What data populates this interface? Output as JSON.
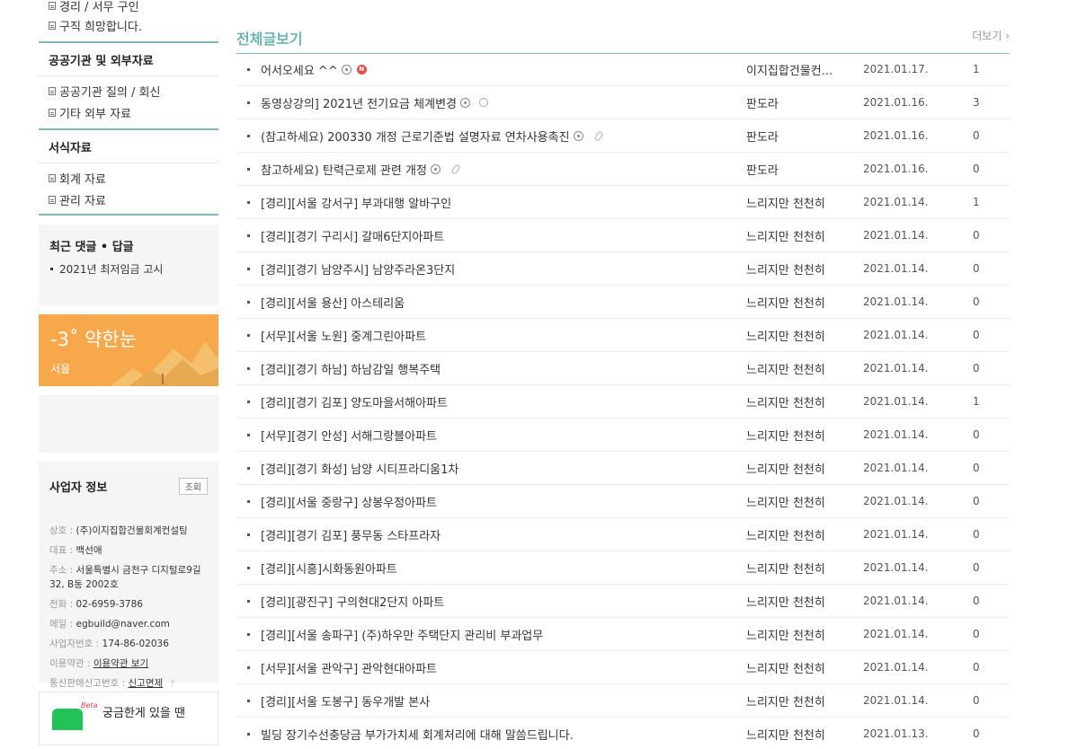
{
  "sidebar": {
    "group1": {
      "items": [
        {
          "label": "경리 / 서무 구인"
        },
        {
          "label": "구직 희망합니다."
        }
      ]
    },
    "group2": {
      "title": "공공기관 및 외부자료",
      "items": [
        {
          "label": "공공기관 질의 / 회신"
        },
        {
          "label": "기타 외부 자료"
        }
      ]
    },
    "group3": {
      "title": "서식자료",
      "items": [
        {
          "label": "회계 자료"
        },
        {
          "label": "관리 자료"
        }
      ]
    },
    "recent": {
      "title": "최근 댓글 • 답글",
      "items": [
        {
          "label": "2021년 최저임금 고시"
        }
      ]
    },
    "weather": {
      "temp": "-3˚ 약한눈",
      "city": "서울"
    },
    "business": {
      "title": "사업자 정보",
      "button": "조회",
      "lines": [
        {
          "key": "상호 : ",
          "value": "(주)이지집합건물회계컨설팅"
        },
        {
          "key": "대표 : ",
          "value": "백선애"
        },
        {
          "key": "주소 : ",
          "value": "서울특별시 금천구 디지털로9길 32, B동 2002호"
        },
        {
          "key": "전화 : ",
          "value": "02-6959-3786"
        },
        {
          "key": "메일 : ",
          "value": "egbuild@naver.com"
        },
        {
          "key": "사업자번호 : ",
          "value": "174-86-02036"
        },
        {
          "key": "이용약관 : ",
          "value": "이용약관 보기"
        },
        {
          "key": "통신판매신고번호 : ",
          "value": "신고면제"
        }
      ],
      "help_mark": "?"
    },
    "help": {
      "beta": "Beta",
      "text": "궁금한게 있을 땐"
    }
  },
  "main": {
    "section_title": "전체글보기",
    "more_label": "더보기 ›",
    "rows": [
      {
        "title": "어서오세요 ^^",
        "author": "이지집합건물컨...",
        "date": "2021.01.17.",
        "count": "1"
      },
      {
        "title": "동영상강의] 2021년 전기요금 체계변경",
        "author": "판도라",
        "date": "2021.01.16.",
        "count": "3"
      },
      {
        "title": "(참고하세요) 200330 개정 근로기준법 설명자료 연차사용촉진",
        "author": "판도라",
        "date": "2021.01.16.",
        "count": "0"
      },
      {
        "title": "참고하세요) 탄력근로제 관련 개정",
        "author": "판도라",
        "date": "2021.01.16.",
        "count": "0"
      },
      {
        "title": "[경리][서울 강서구] 부과대행 알바구인",
        "author": "느리지만 천천히",
        "date": "2021.01.14.",
        "count": "1"
      },
      {
        "title": "[경리][경기 구리시] 갈매6단지아파트",
        "author": "느리지만 천천히",
        "date": "2021.01.14.",
        "count": "0"
      },
      {
        "title": "[경리][경기 남양주시] 남양주라온3단지",
        "author": "느리지만 천천히",
        "date": "2021.01.14.",
        "count": "0"
      },
      {
        "title": "[경리][서울 용산] 아스테리움",
        "author": "느리지만 천천히",
        "date": "2021.01.14.",
        "count": "0"
      },
      {
        "title": "[서무][서울 노원] 중계그린아파트",
        "author": "느리지만 천천히",
        "date": "2021.01.14.",
        "count": "0"
      },
      {
        "title": "[경리][경기 하남] 하남감일 행복주택",
        "author": "느리지만 천천히",
        "date": "2021.01.14.",
        "count": "0"
      },
      {
        "title": "[경리][경기 김포] 양도마을서해아파트",
        "author": "느리지만 천천히",
        "date": "2021.01.14.",
        "count": "1"
      },
      {
        "title": "[서무][경기 안성] 서해그랑블아파트",
        "author": "느리지만 천천히",
        "date": "2021.01.14.",
        "count": "0"
      },
      {
        "title": "[경리][경기 화성] 남양 시티프라디움1차",
        "author": "느리지만 천천히",
        "date": "2021.01.14.",
        "count": "0"
      },
      {
        "title": "[경리][서울 중랑구] 상봉우정아파트",
        "author": "느리지만 천천히",
        "date": "2021.01.14.",
        "count": "0"
      },
      {
        "title": "[경리][경기 김포] 풍무동 스타프라자",
        "author": "느리지만 천천히",
        "date": "2021.01.14.",
        "count": "0"
      },
      {
        "title": "[경리][시흥]시화동원아파트",
        "author": "느리지만 천천히",
        "date": "2021.01.14.",
        "count": "0"
      },
      {
        "title": "[경리][광진구] 구의현대2단지 아파트",
        "author": "느리지만 천천히",
        "date": "2021.01.14.",
        "count": "0"
      },
      {
        "title": "[경리][서울 송파구] (주)하우만 주택단지 관리비 부과업무",
        "author": "느리지만 천천히",
        "date": "2021.01.14.",
        "count": "0"
      },
      {
        "title": "[서무][서울 관악구] 관악현대아파트",
        "author": "느리지만 천천히",
        "date": "2021.01.14.",
        "count": "0"
      },
      {
        "title": "[경리][서울 도봉구] 동우개발 본사",
        "author": "느리지만 천천히",
        "date": "2021.01.14.",
        "count": "0"
      },
      {
        "title": "빌딩 장기수선충당금 부가가치세 회계처리에 대해 말씀드립니다.",
        "author": "느리지만 천천히",
        "date": "2021.01.13.",
        "count": "0"
      }
    ]
  }
}
